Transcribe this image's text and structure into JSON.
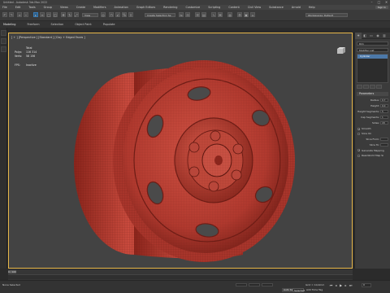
{
  "app": {
    "title": "Untitled - Autodesk 3ds Max 2022",
    "window_controls": [
      "–",
      "□",
      "✕"
    ]
  },
  "menu": {
    "items": [
      "File",
      "Edit",
      "Tools",
      "Group",
      "Views",
      "Create",
      "Modifiers",
      "Animation",
      "Graph Editors",
      "Rendering",
      "Customize",
      "Scripting",
      "Content",
      "Civil View",
      "Substance",
      "Arnold",
      "Help"
    ],
    "signin_label": "Sign In"
  },
  "toolbar": {
    "ref_coord": "View",
    "selection_set": "Create Selection Se",
    "workspace": "Workspaces: Default"
  },
  "ribbon": {
    "tabs": [
      "Modeling",
      "Freeform",
      "Selection",
      "Object Paint",
      "Populate"
    ],
    "active": "Modeling"
  },
  "viewport": {
    "label": "[ + ] [Perspective ] [Standard ] [Clay + Edged Faces ]",
    "stats": {
      "header": "Total",
      "polys_label": "Polys:",
      "polys_value": "116 314",
      "verts_label": "Verts:",
      "verts_value": "58 156",
      "fps_label": "FPS:",
      "fps_value": "Inactive"
    },
    "model_color": "#c2473b",
    "border_color": "#e8b84a"
  },
  "command_panel": {
    "tabs": [
      "+",
      "◧",
      "▭",
      "◉",
      "▥",
      "⚒"
    ],
    "object_name": "Rim",
    "modifier_list_label": "Modifier List",
    "stack_selected": "Cylinder",
    "rollout_title": "Parameters",
    "params": [
      {
        "label": "Radius:",
        "value": "0,7"
      },
      {
        "label": "Height:",
        "value": "0,0"
      },
      {
        "label": "Height Segments:",
        "value": "5"
      },
      {
        "label": "Cap Segments:",
        "value": "1"
      },
      {
        "label": "Sides:",
        "value": "18"
      }
    ],
    "checks": [
      {
        "label": "Smooth",
        "checked": true
      },
      {
        "label": "Slice On",
        "checked": false
      },
      {
        "label": "Generate Mapping",
        "checked": true
      },
      {
        "label": "Real-World Map Si",
        "checked": false
      }
    ],
    "slice_from_label": "Slice From:",
    "slice_to_label": "Slice To:"
  },
  "timeline": {
    "slider_label": "0 / 100"
  },
  "status": {
    "message": "None Selected",
    "grid": "Grid = 10,0mm",
    "autokey": "Auto Key",
    "selected": "Selected",
    "add_time_tag": "Add Time Tag",
    "frame": "0"
  }
}
